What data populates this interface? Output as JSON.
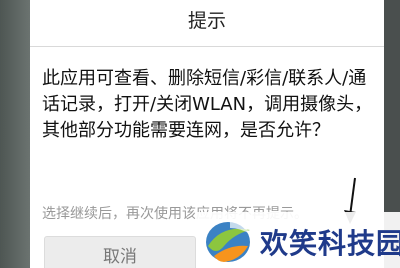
{
  "dialog": {
    "title": "提示",
    "message": "此应用可查看、删除短信/彩信/联系人/通话记录，打开/关闭WLAN，调用摄像头，其他部分功能需要连网，是否允许？",
    "hint": "选择继续后，再次使用该应用将不再提示。",
    "cancel_label": "取消"
  },
  "watermark": {
    "text": "欢笑科技园"
  },
  "colors": {
    "dialog_bg": "#ffffff",
    "backdrop": "#5b6360",
    "hint_text": "#999999",
    "watermark_text": "#1f3a8a"
  }
}
